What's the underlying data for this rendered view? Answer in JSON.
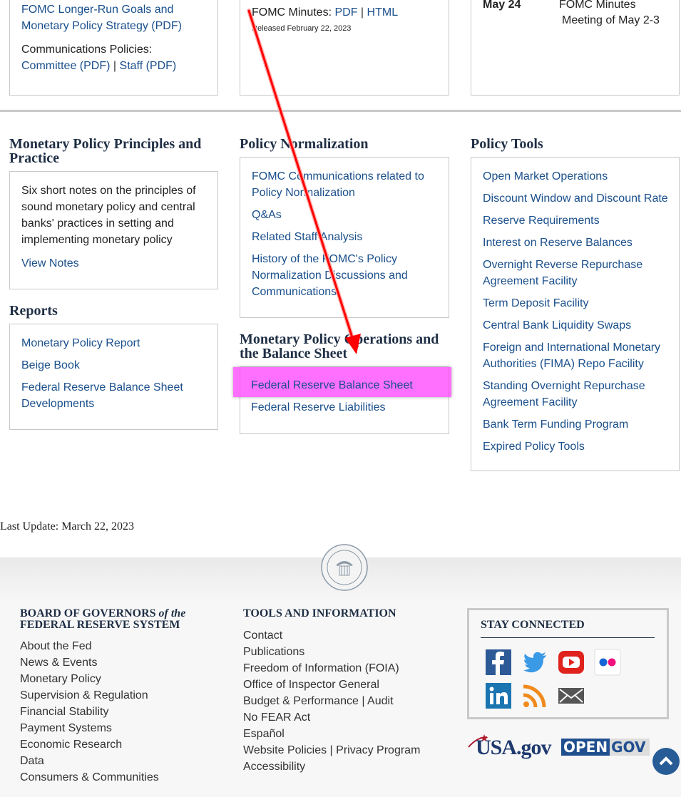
{
  "top": {
    "col1": {
      "goals_link": "FOMC Longer-Run Goals and Monetary Policy Strategy (PDF)",
      "comm_label": "Communications Policies:",
      "committee_link": "Committee (PDF)",
      "sep": "|",
      "staff_link": "Staff (PDF)"
    },
    "col2": {
      "minutes_label": "FOMC Minutes:",
      "pdf_link": "PDF",
      "sep": "|",
      "html_link": "HTML",
      "released": "Released February 22, 2023"
    },
    "col3": {
      "date": "May 24",
      "event_line1": "FOMC Minutes",
      "event_line2": "Meeting of May 2-3"
    }
  },
  "principles": {
    "title": "Monetary Policy Principles and Practice",
    "text": "Six short notes on the principles of sound monetary policy and central banks' practices in setting and implementing monetary policy",
    "link": "View Notes"
  },
  "reports": {
    "title": "Reports",
    "items": [
      "Monetary Policy Report",
      "Beige Book",
      "Federal Reserve Balance Sheet Developments"
    ]
  },
  "normalization": {
    "title": "Policy Normalization",
    "items": [
      "FOMC Communications related to Policy Normalization",
      "Q&As",
      "Related Staff Analysis",
      "History of the FOMC's Policy Normalization Discussions and Communications"
    ]
  },
  "operations": {
    "title": "Monetary Policy Operations and the Balance Sheet",
    "items": [
      "Federal Reserve Balance Sheet",
      "Federal Reserve Liabilities"
    ]
  },
  "tools": {
    "title": "Policy Tools",
    "items": [
      "Open Market Operations",
      "Discount Window and Discount Rate",
      "Reserve Requirements",
      "Interest on Reserve Balances",
      "Overnight Reverse Repurchase Agreement Facility",
      "Term Deposit Facility",
      "Central Bank Liquidity Swaps",
      "Foreign and International Monetary Authorities (FIMA) Repo Facility",
      "Standing Overnight Repurchase Agreement Facility",
      "Bank Term Funding Program",
      "Expired Policy Tools"
    ]
  },
  "last_update": "Last Update: March 22, 2023",
  "footer": {
    "board_line1": "BOARD OF GOVERNORS",
    "board_of_the": "of the",
    "board_line2": "FEDERAL RESERVE SYSTEM",
    "board_links": [
      "About the Fed",
      "News & Events",
      "Monetary Policy",
      "Supervision & Regulation",
      "Financial Stability",
      "Payment Systems",
      "Economic Research",
      "Data",
      "Consumers & Communities"
    ],
    "tools_title": "TOOLS AND INFORMATION",
    "tools_links": [
      "Contact",
      "Publications",
      "Freedom of Information (FOIA)",
      "Office of Inspector General"
    ],
    "budget": "Budget & Performance",
    "audit": "Audit",
    "tools_links2": [
      "No FEAR Act",
      "Español"
    ],
    "website_policies": "Website Policies",
    "privacy": "Privacy Program",
    "accessibility": "Accessibility",
    "sep": "|",
    "stay_connected": "STAY CONNECTED",
    "usa_logo": "USA.gov",
    "opengov_open": "OPEN",
    "opengov_gov": "GOV"
  },
  "colors": {
    "link": "#1a4f8b",
    "heading": "#1f2f45",
    "highlight": "#ff40ff",
    "arrow": "#ff0000"
  },
  "icons": [
    "facebook-icon",
    "twitter-icon",
    "youtube-icon",
    "flickr-icon",
    "linkedin-icon",
    "rss-icon",
    "email-icon",
    "fed-seal-icon",
    "back-to-top-icon",
    "annotation-arrow-icon"
  ]
}
